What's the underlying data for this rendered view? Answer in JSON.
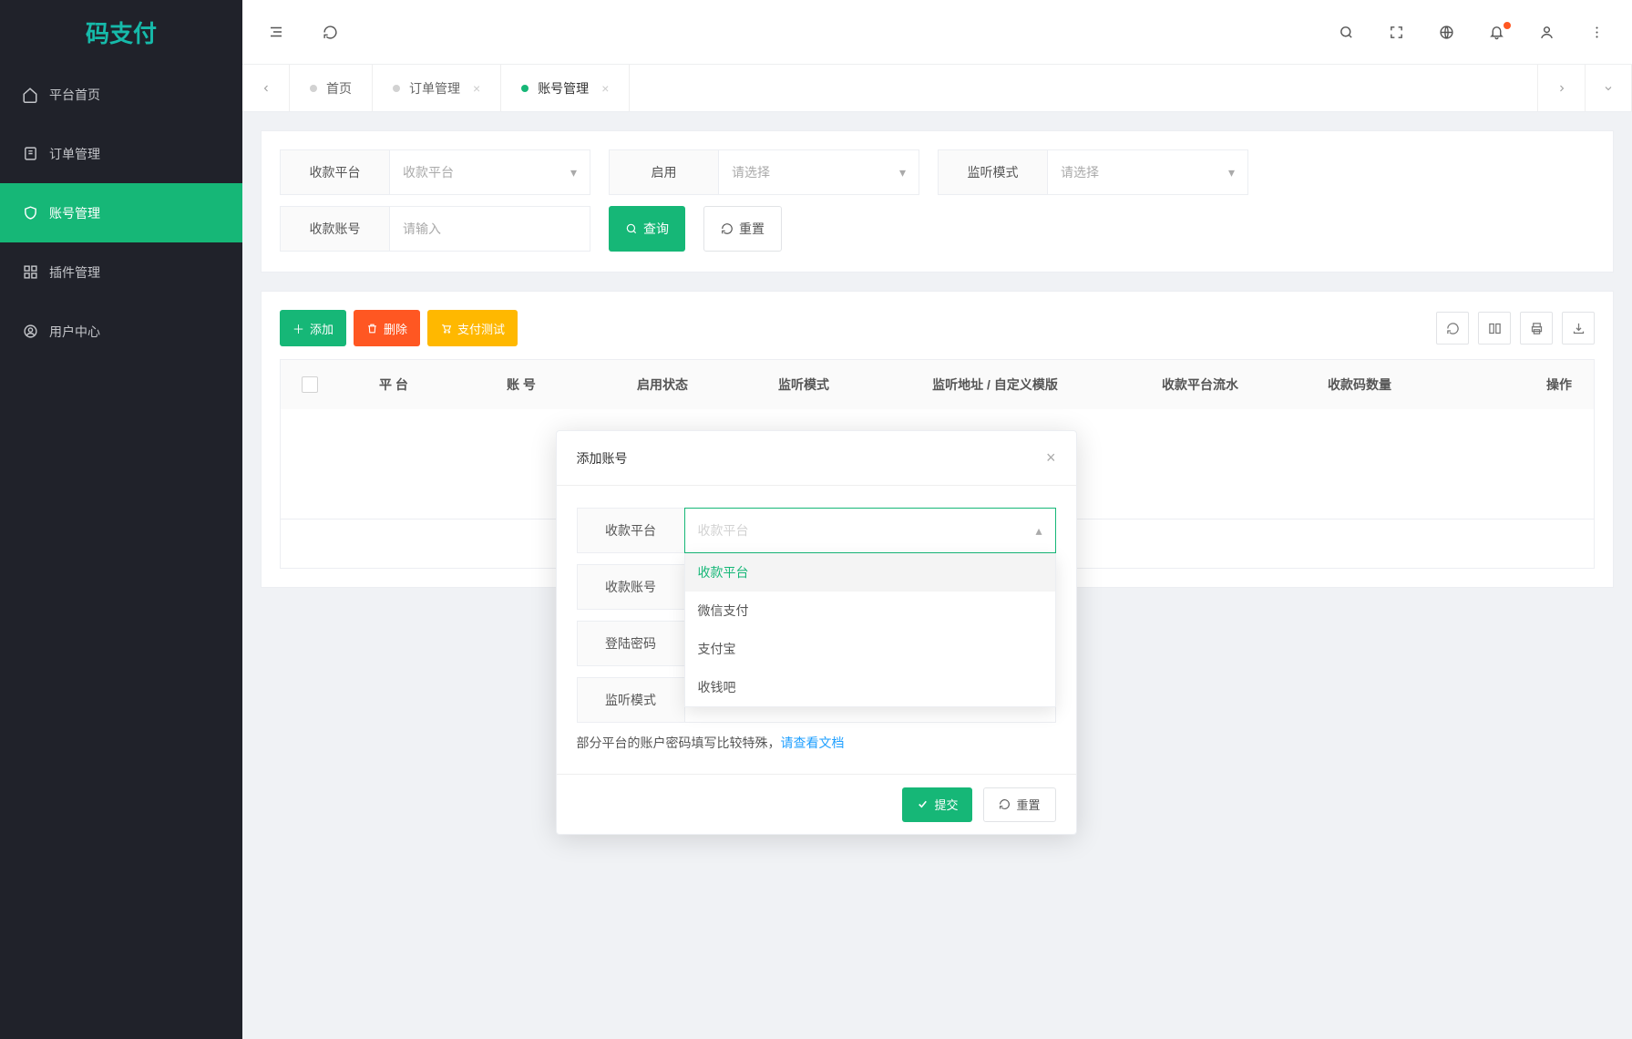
{
  "brand": "码支付",
  "sidebar": {
    "items": [
      {
        "label": "平台首页"
      },
      {
        "label": "订单管理"
      },
      {
        "label": "账号管理"
      },
      {
        "label": "插件管理"
      },
      {
        "label": "用户中心"
      }
    ]
  },
  "tabs": {
    "items": [
      {
        "label": "首页",
        "closable": false,
        "active": false
      },
      {
        "label": "订单管理",
        "closable": true,
        "active": false
      },
      {
        "label": "账号管理",
        "closable": true,
        "active": true
      }
    ]
  },
  "filters": {
    "platform_label": "收款平台",
    "platform_placeholder": "收款平台",
    "enable_label": "启用",
    "enable_placeholder": "请选择",
    "listen_label": "监听模式",
    "listen_placeholder": "请选择",
    "account_label": "收款账号",
    "account_placeholder": "请输入",
    "search": "查询",
    "reset": "重置"
  },
  "actions": {
    "add": "添加",
    "delete": "删除",
    "paytest": "支付测试"
  },
  "table": {
    "cols": [
      "平 台",
      "账 号",
      "启用状态",
      "监听模式",
      "监听地址 / 自定义模版",
      "收款平台流水",
      "收款码数量",
      "操作"
    ],
    "rows": []
  },
  "modal": {
    "title": "添加账号",
    "fields": {
      "platform_label": "收款平台",
      "platform_placeholder": "收款平台",
      "account_label": "收款账号",
      "password_label": "登陆密码",
      "listen_label": "监听模式",
      "options": [
        "收款平台",
        "微信支付",
        "支付宝",
        "收钱吧"
      ]
    },
    "hint_text": "部分平台的账户密码填写比较特殊，",
    "hint_link": "请查看文档",
    "submit": "提交",
    "reset": "重置"
  }
}
